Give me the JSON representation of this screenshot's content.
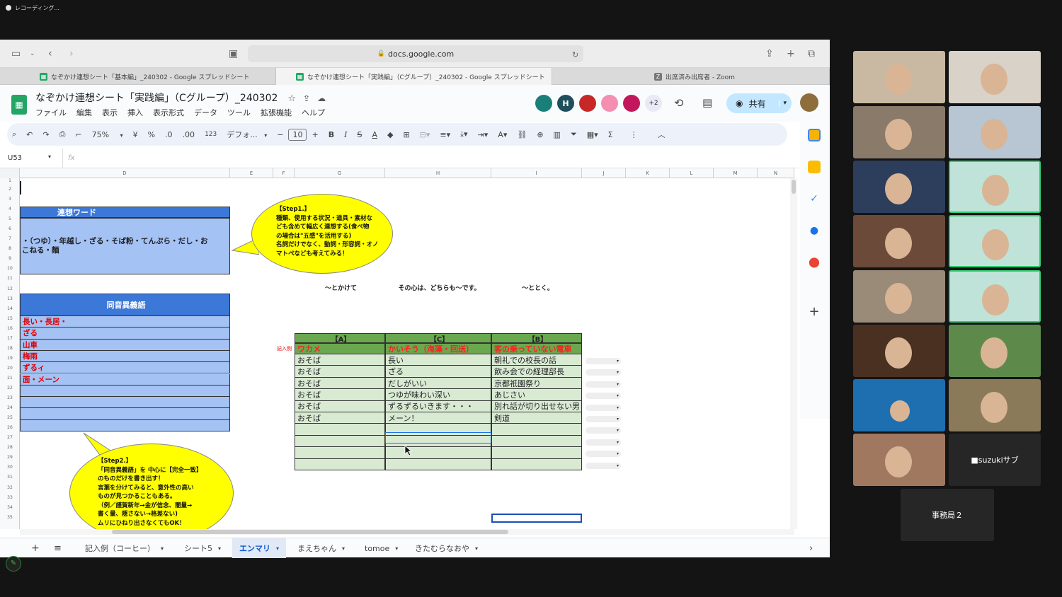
{
  "recording": {
    "label": "レコーディング..."
  },
  "browser": {
    "url": "docs.google.com",
    "tabs": [
      {
        "label": "なぞかけ連想シート「基本編」_240302 - Google スプレッドシート"
      },
      {
        "label": "なぞかけ連想シート「実践編」（Cグループ）_240302 - Google スプレッドシート"
      },
      {
        "label": "出席済み出席者 - Zoom"
      }
    ]
  },
  "sheet": {
    "title": "なぞかけ連想シート「実践編」（Cグループ）_240302",
    "menus": [
      "ファイル",
      "編集",
      "表示",
      "挿入",
      "表示形式",
      "データ",
      "ツール",
      "拡張機能",
      "ヘルプ"
    ],
    "collaborators": [
      {
        "label": "",
        "color": "#1b7f79"
      },
      {
        "label": "H",
        "color": "#1f4e5c"
      },
      {
        "label": "",
        "color": "#c62828"
      },
      {
        "label": "",
        "color": "#f48fb1"
      },
      {
        "label": "",
        "color": "#c2185b"
      }
    ],
    "more_collaborators": "+2",
    "share_label": "共有",
    "toolbar": {
      "zoom": "75%",
      "currency": "¥",
      "percent": "%",
      "dec_less": ".0",
      "dec_more": ".00",
      "format123": "123",
      "font": "デフォ...",
      "font_size": "10"
    },
    "name_box": "U53",
    "fx": "fx",
    "columns": [
      "D",
      "E",
      "F",
      "G",
      "H",
      "I",
      "J",
      "K",
      "L",
      "M",
      "N"
    ],
    "rows": [
      "1",
      "2",
      "3",
      "4",
      "5",
      "6",
      "7",
      "8",
      "9",
      "10",
      "11",
      "12",
      "13",
      "14",
      "15",
      "16",
      "17",
      "18",
      "19",
      "20",
      "21",
      "22",
      "23",
      "24",
      "25",
      "26",
      "27",
      "28",
      "29",
      "30",
      "31",
      "32",
      "33",
      "34",
      "35"
    ],
    "assoc_header": "連想ワード",
    "assoc_text_line1": "・（つゆ）・年越し・ざる・そば粉・てんぷら・だし・お",
    "assoc_text_line2": "こねる・麺",
    "homonym_header": "同音異義語",
    "homonyms": [
      "長い・長居・",
      "ざる",
      "山車",
      "梅雨",
      "ずるィ",
      "面・メーン"
    ],
    "step1_lines": [
      "【Step1.】",
      "種類、使用する状況・道具・素材な",
      "ども含めて幅広く連想する(食べ物",
      "の場合は\"五感\"を活用する)",
      "名詞だけでなく、動詞・形容詞・オノ",
      "マトペなども考えてみる！"
    ],
    "step2_lines": [
      "【Step2.】",
      "「同音異義語」を 中心に【完全一致】",
      "のものだけを書き出す！",
      "言葉を分けてみると、意外性の高い",
      "ものが見つかることもある。",
      "（例／謹賀新年→金が信念、闇量→",
      "書く量、隠さない→格差ない)",
      "ムリにひねり出さなくてもOK！"
    ],
    "table": {
      "top_labels": [
        "〜とかけて",
        "その心は、どちらも〜です。",
        "〜ととく。"
      ],
      "headers": [
        "【A】",
        "【C】",
        "【B】"
      ],
      "example_label": "記入例",
      "example": [
        "ワカメ",
        "かいそう（海藻・回送）",
        "客の乗っていない電車"
      ],
      "rows": [
        [
          "おそば",
          "長い",
          "朝礼での校長の話"
        ],
        [
          "おそば",
          "ざる",
          "飲み会での経理部長"
        ],
        [
          "おそば",
          "だしがいい",
          "京都祇園祭り"
        ],
        [
          "おそば",
          "つゆが味わい深い",
          "あじさい"
        ],
        [
          "おそば",
          "ずるずるいきます・・・",
          "別れ話が切り出せない男"
        ],
        [
          "おそば",
          "メーン！",
          "剣道"
        ]
      ]
    },
    "sheet_tabs": [
      "記入例（コーヒー）",
      "シート5",
      "エンマリ",
      "まえちゃん",
      "tomoe",
      "きたむらなおや"
    ],
    "active_sheet_tab": "エンマリ"
  },
  "zoom": {
    "name_tiles": [
      "■suzukiサブ",
      "事務局２"
    ]
  }
}
